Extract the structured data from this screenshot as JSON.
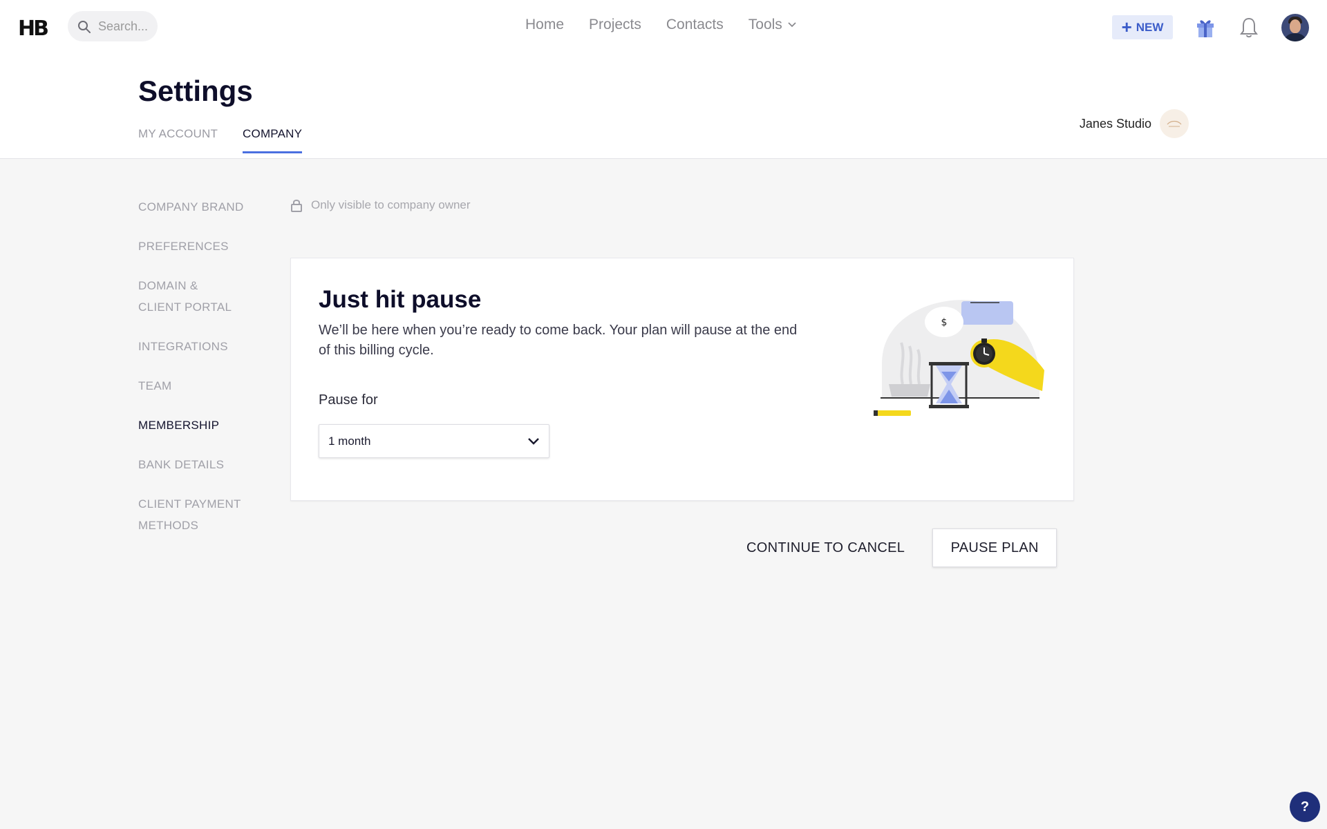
{
  "topbar": {
    "logo": "HB",
    "search_placeholder": "Search...",
    "nav": [
      "Home",
      "Projects",
      "Contacts",
      "Tools"
    ],
    "new_label": "NEW"
  },
  "header": {
    "title": "Settings",
    "tabs": [
      "MY ACCOUNT",
      "COMPANY"
    ],
    "active_tab": "COMPANY",
    "studio_name": "Janes Studio"
  },
  "sidebar": {
    "items": [
      "COMPANY BRAND",
      "PREFERENCES",
      "DOMAIN & CLIENT PORTAL",
      "INTEGRATIONS",
      "TEAM",
      "MEMBERSHIP",
      "BANK DETAILS",
      "CLIENT PAYMENT METHODS"
    ],
    "active": "MEMBERSHIP"
  },
  "content": {
    "visibility_note": "Only visible to company owner",
    "card_title": "Just hit pause",
    "card_description": "We’ll be here when you’re ready to come back. Your plan will pause at the end of this billing cycle.",
    "pause_label": "Pause for",
    "pause_value": "1 month",
    "illustration_symbol": "$"
  },
  "actions": {
    "continue_cancel": "CONTINUE TO CANCEL",
    "pause_plan": "PAUSE PLAN"
  },
  "help_label": "?",
  "colors": {
    "accent": "#4a6fe0",
    "new_button_bg": "#e6ebfa",
    "new_button_text": "#3b5cc9",
    "help_bg": "#1f2f7a"
  }
}
